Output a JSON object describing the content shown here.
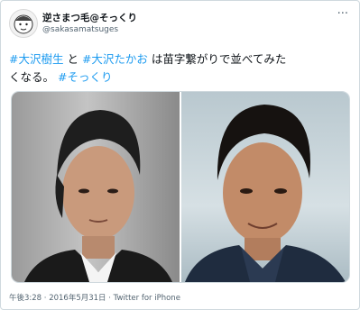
{
  "tweet": {
    "display_name": "逆さまつ毛@そっくり",
    "handle": "@sakasamatsuges",
    "more_icon": "more-horizontal-icon",
    "text_parts": [
      {
        "text": "#大沢樹生",
        "type": "hashtag"
      },
      {
        "text": " と ",
        "type": "plain"
      },
      {
        "text": "#大沢たかお",
        "type": "hashtag"
      },
      {
        "text": " は苗字繋がりで並べてみた",
        "type": "plain"
      },
      {
        "text": "くなる。 ",
        "type": "plain"
      },
      {
        "text": "#そっくり",
        "type": "hashtag"
      }
    ],
    "footer": "午後3:28 · 2016年5月31日 · Twitter for iPhone"
  },
  "colors": {
    "hashtag": "#1d9bf0",
    "secondary_text": "#536471",
    "border": "#cfd9de"
  }
}
